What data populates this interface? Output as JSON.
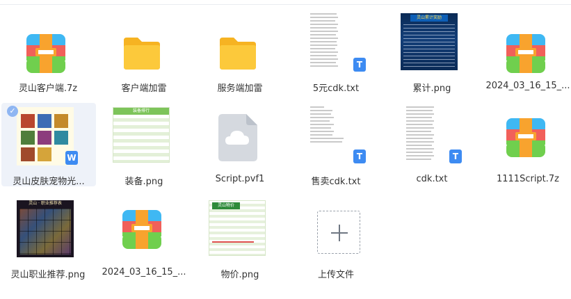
{
  "files": [
    {
      "id": "f1",
      "name": "灵山客户端.7z",
      "kind": "archive"
    },
    {
      "id": "f2",
      "name": "客户端加雷",
      "kind": "folder"
    },
    {
      "id": "f3",
      "name": "服务端加雷",
      "kind": "folder"
    },
    {
      "id": "f4",
      "name": "5元cdk.txt",
      "kind": "text"
    },
    {
      "id": "f5",
      "name": "累计.png",
      "kind": "image"
    },
    {
      "id": "f6",
      "name": "2024_03_16_15_...",
      "kind": "archive"
    },
    {
      "id": "f7",
      "name": "灵山皮肤宠物光...",
      "kind": "word",
      "selected": true
    },
    {
      "id": "f8",
      "name": "装备.png",
      "kind": "image"
    },
    {
      "id": "f9",
      "name": "Script.pvf1",
      "kind": "unknown"
    },
    {
      "id": "f10",
      "name": "售卖cdk.txt",
      "kind": "text"
    },
    {
      "id": "f11",
      "name": "cdk.txt",
      "kind": "text"
    },
    {
      "id": "f12",
      "name": "1111Script.7z",
      "kind": "archive"
    },
    {
      "id": "f13",
      "name": "灵山职业推荐.png",
      "kind": "image"
    },
    {
      "id": "f14",
      "name": "2024_03_16_15_...",
      "kind": "archive"
    },
    {
      "id": "f15",
      "name": "物价.png",
      "kind": "image"
    }
  ],
  "upload": {
    "label": "上传文件"
  },
  "badges": {
    "text": "T",
    "word": "W"
  },
  "thumb_text": {
    "leiji_title": "灵山累计奖励",
    "zhuangbei_title": "装备排行",
    "zhiye_title": "灵山 · 职业推荐表",
    "wujia_title": "灵山物价"
  },
  "colors": {
    "accent": "#3d8bf2",
    "folder": "#fcc93b",
    "selected_bg": "#eef2f9"
  }
}
